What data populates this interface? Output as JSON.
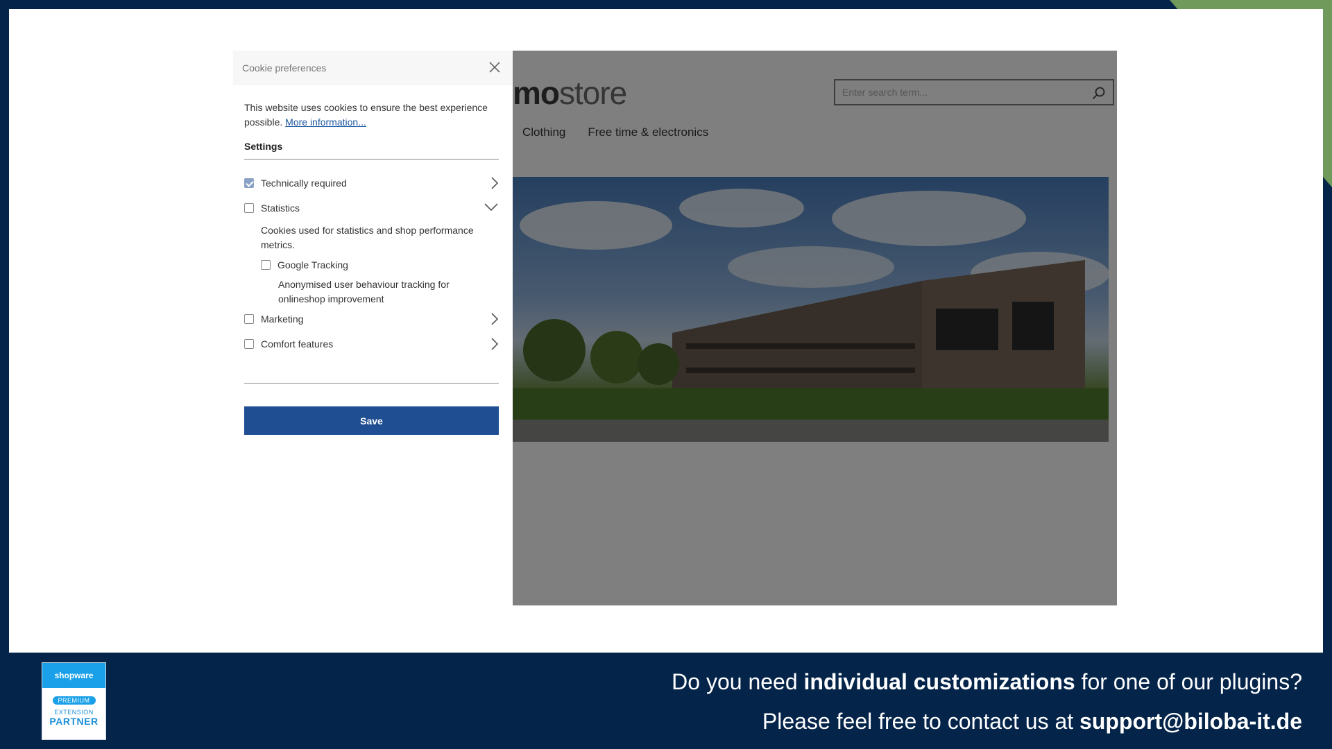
{
  "shop": {
    "logo_bold": "mo",
    "logo_rest": "store",
    "search_placeholder": "Enter search term...",
    "nav": [
      "Clothing",
      "Free time & electronics"
    ]
  },
  "cookie_modal": {
    "title": "Cookie preferences",
    "intro": "This website uses cookies to ensure the best experience possible.",
    "more_link": "More information...",
    "settings_title": "Settings",
    "categories": [
      {
        "label": "Technically required",
        "checked": true,
        "expanded": false
      },
      {
        "label": "Statistics",
        "checked": false,
        "expanded": true,
        "description": "Cookies used for statistics and shop performance metrics.",
        "sub": {
          "label": "Google Tracking",
          "checked": false,
          "description": "Anonymised user behaviour tracking for onlineshop improvement"
        }
      },
      {
        "label": "Marketing",
        "checked": false,
        "expanded": false
      },
      {
        "label": "Comfort features",
        "checked": false,
        "expanded": false
      }
    ],
    "save_label": "Save"
  },
  "badge": {
    "brand": "shopware",
    "tier": "PREMIUM",
    "line1": "EXTENSION",
    "line2": "PARTNER"
  },
  "footer": {
    "line1_pre": "Do you need ",
    "line1_bold": "individual customizations",
    "line1_post": " for one of our plugins?",
    "line2_pre": "Please feel free to contact us at ",
    "line2_bold": "support@biloba-it.de"
  },
  "colors": {
    "background": "#04244a",
    "accent_green": "#6f9a5c",
    "save_button": "#1f4f92",
    "link": "#1c56a0"
  }
}
